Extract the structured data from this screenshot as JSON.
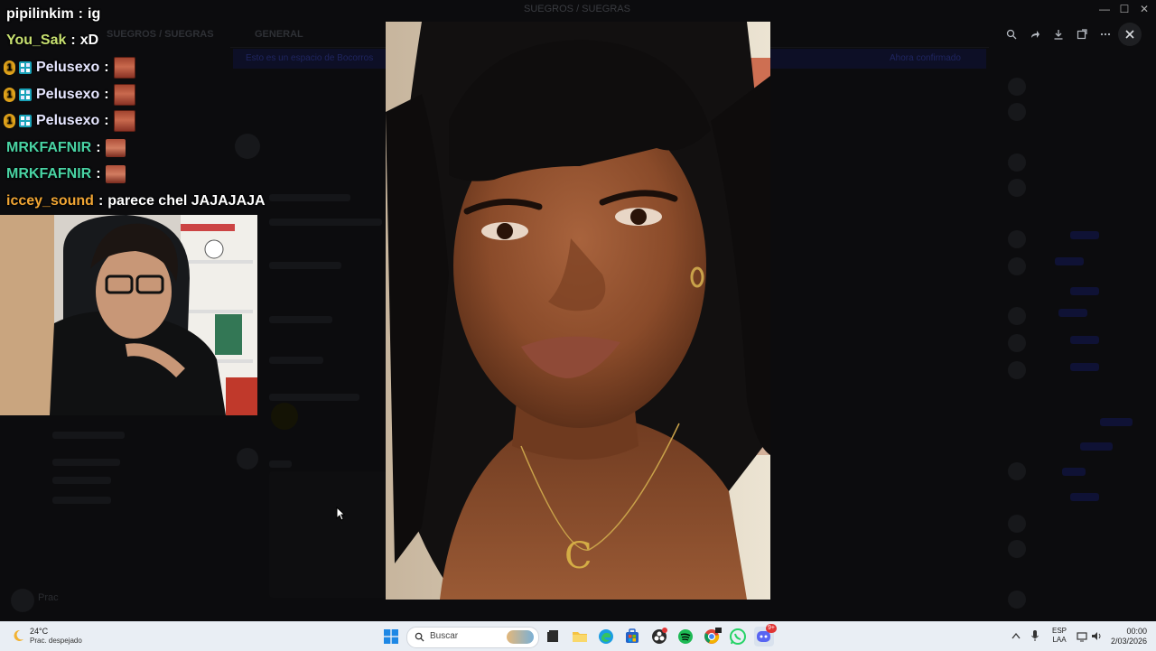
{
  "window": {
    "title": "SUEGROS / SUEGRAS",
    "controls": [
      "minimize",
      "maximize",
      "close"
    ]
  },
  "discord": {
    "server_name": "SUEGROS / SUEGRAS",
    "channel_name": "GENERAL",
    "banner_text": "Esto es un espacio de Bocorros",
    "banner_button": "Ahora confirmado",
    "user_status": "Prac"
  },
  "viewer": {
    "tools": [
      "zoom-icon",
      "forward-icon",
      "download-icon",
      "open-external-icon",
      "more-icon"
    ],
    "close_label": "✕"
  },
  "chat": [
    {
      "user": "pipilinkim",
      "color": "#ffffff",
      "message": "ig",
      "badges": []
    },
    {
      "user": "You_Sak",
      "color": "#c7e070",
      "message": "xD",
      "badges": []
    },
    {
      "user": "Pelusexo",
      "color": "#e6e6ff",
      "message": "",
      "badges": [
        "1",
        "gift"
      ],
      "emote": true
    },
    {
      "user": "Pelusexo",
      "color": "#e6e6ff",
      "message": "",
      "badges": [
        "1",
        "gift"
      ],
      "emote": true
    },
    {
      "user": "Pelusexo",
      "color": "#e6e6ff",
      "message": "",
      "badges": [
        "1",
        "gift"
      ],
      "emote": true
    },
    {
      "user": "MRKFAFNIR",
      "color": "#49d4a4",
      "message": "",
      "badges": [],
      "emote": true
    },
    {
      "user": "MRKFAFNIR",
      "color": "#49d4a4",
      "message": "",
      "badges": [],
      "emote": true
    },
    {
      "user": "iccey_sound",
      "color": "#f0a534",
      "message": "parece chel JAJAJAJA",
      "badges": []
    }
  ],
  "chat_separator": ":",
  "taskbar": {
    "weather_temp": "24°C",
    "weather_desc": "Prac. despejado",
    "search_placeholder": "Buscar",
    "lang_line1": "ESP",
    "lang_line2": "LAA",
    "time": "00:00",
    "date": "2/03/2026",
    "notification_count": "9+"
  }
}
